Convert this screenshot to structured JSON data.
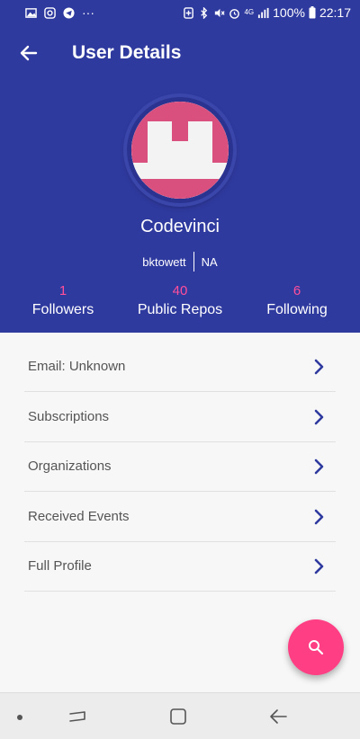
{
  "status_bar": {
    "battery": "100%",
    "time": "22:17",
    "network": "4G",
    "more": "···"
  },
  "app_bar": {
    "title": "User Details"
  },
  "profile": {
    "name": "Codevinci",
    "login": "bktowett",
    "location": "NA",
    "stats": [
      {
        "value": "1",
        "label": "Followers"
      },
      {
        "value": "40",
        "label": "Public Repos"
      },
      {
        "value": "6",
        "label": "Following"
      }
    ]
  },
  "menu": [
    {
      "label": "Email: Unknown"
    },
    {
      "label": "Subscriptions"
    },
    {
      "label": "Organizations"
    },
    {
      "label": "Received Events"
    },
    {
      "label": "Full Profile"
    }
  ],
  "colors": {
    "primary": "#2f3a9f",
    "accent": "#ff3e84",
    "stat_number": "#ff4f9a"
  },
  "icons": {
    "back": "arrow-left-icon",
    "chevron": "chevron-right-icon",
    "fab": "search-icon"
  }
}
